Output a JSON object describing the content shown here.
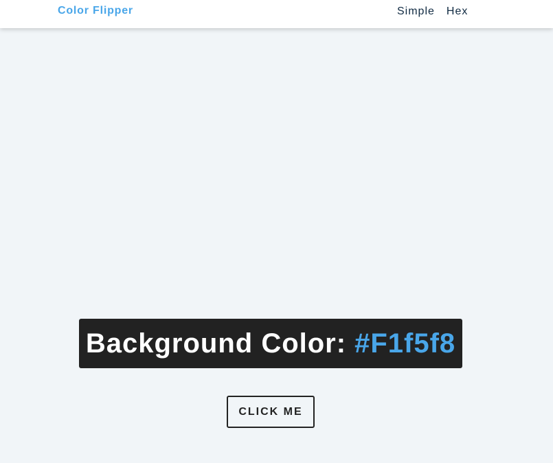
{
  "navbar": {
    "brand": "Color Flipper",
    "links": [
      {
        "label": "Simple"
      },
      {
        "label": "Hex"
      }
    ]
  },
  "banner": {
    "label": "Background Color:",
    "value": "#F1f5f8"
  },
  "button": {
    "label": "CLICK ME"
  },
  "colors": {
    "page_background": "#f1f5f8",
    "accent": "#49a6e9",
    "nav_text": "#102a42",
    "banner_background": "#222222"
  }
}
